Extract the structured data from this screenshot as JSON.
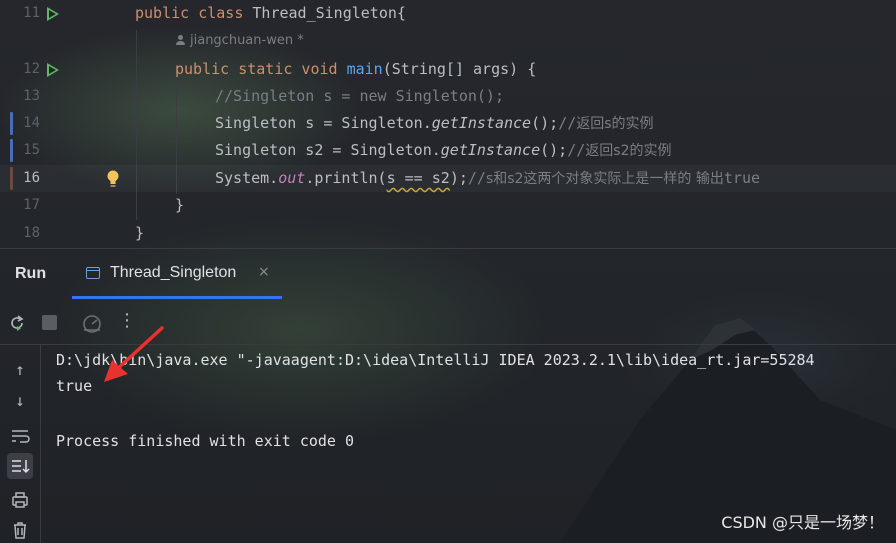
{
  "editor": {
    "lines": [
      {
        "num": "11",
        "tokens": [
          [
            "kw",
            "public class "
          ],
          [
            "plain",
            "Thread_Singleton{"
          ]
        ]
      },
      {
        "num": "12",
        "tokens": [
          [
            "kw",
            "public static void "
          ],
          [
            "fn",
            "main"
          ],
          [
            "plain",
            "(String[] args) {"
          ]
        ]
      },
      {
        "num": "13",
        "tokens": [
          [
            "cm",
            "//Singleton s = new Singleton();"
          ]
        ]
      },
      {
        "num": "14",
        "tokens": [
          [
            "plain",
            "Singleton s = Singleton."
          ],
          [
            "it",
            "getInstance"
          ],
          [
            "plain",
            "();"
          ],
          [
            "cm",
            "//"
          ],
          [
            "cmcn",
            "返回s的实例"
          ]
        ]
      },
      {
        "num": "15",
        "tokens": [
          [
            "plain",
            "Singleton s2 = Singleton."
          ],
          [
            "it",
            "getInstance"
          ],
          [
            "plain",
            "();"
          ],
          [
            "cm",
            "//"
          ],
          [
            "cmcn",
            "返回s2的实例"
          ]
        ]
      },
      {
        "num": "16",
        "tokens": [
          [
            "plain",
            "System."
          ],
          [
            "field",
            "out"
          ],
          [
            "plain",
            ".println("
          ],
          [
            "warn",
            "s == s2"
          ],
          [
            "plain",
            ");"
          ],
          [
            "cm",
            "//"
          ],
          [
            "cmcn",
            "s和s2这两个对象实际上是一样的 输出"
          ],
          [
            "cm",
            "true"
          ]
        ]
      },
      {
        "num": "17",
        "tokens": [
          [
            "plain",
            "}"
          ]
        ]
      },
      {
        "num": "18",
        "tokens": [
          [
            "plain",
            "}"
          ]
        ]
      }
    ],
    "author": "jiangchuan-wen *"
  },
  "run_panel": {
    "title": "Run",
    "tab_label": "Thread_Singleton",
    "tab_close": "×",
    "toolbar": {
      "more": "⋮"
    },
    "console": {
      "lines": [
        "D:\\jdk\\bin\\java.exe \"-javaagent:D:\\idea\\IntelliJ IDEA 2023.2.1\\lib\\idea_rt.jar=55284",
        "true",
        "",
        "Process finished with exit code 0"
      ]
    }
  },
  "watermark": "CSDN @只是一场梦！",
  "colors": {
    "accent": "#3574f0",
    "run_green": "#5fb865",
    "annotation_arrow": "#e8322f"
  }
}
